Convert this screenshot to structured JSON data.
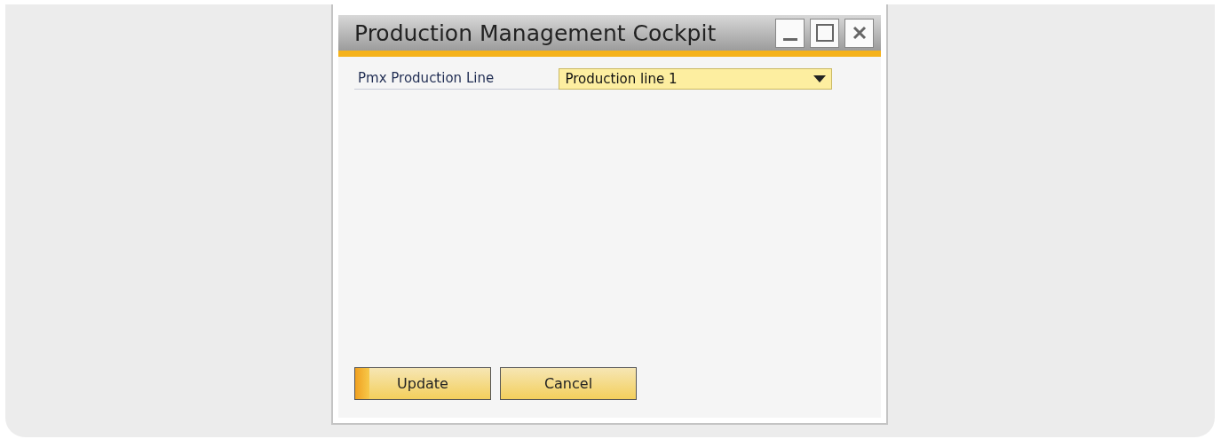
{
  "window": {
    "title": "Production Management Cockpit"
  },
  "field": {
    "label": "Pmx Production Line",
    "value": "Production line 1"
  },
  "buttons": [
    {
      "label": "Update",
      "default": true
    },
    {
      "label": "Cancel",
      "default": false
    }
  ]
}
